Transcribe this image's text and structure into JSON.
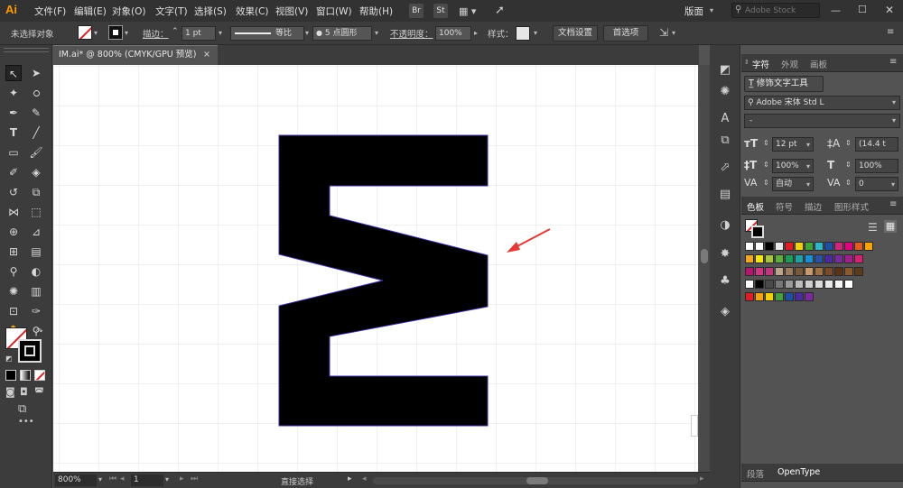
{
  "app": {
    "logo": "Ai"
  },
  "menu": {
    "items": [
      "文件(F)",
      "编辑(E)",
      "对象(O)",
      "文字(T)",
      "选择(S)",
      "效果(C)",
      "视图(V)",
      "窗口(W)",
      "帮助(H)"
    ],
    "br": "Br",
    "st": "St",
    "workspace": "版面",
    "search_placeholder": "Adobe Stock"
  },
  "control": {
    "no_selection": "未选择对象",
    "stroke_label": "描边：",
    "stroke_value": "1 pt",
    "stroke_profile": "等比",
    "brush": "5 点圆形",
    "opacity_label": "不透明度：",
    "opacity_value": "100%",
    "style_label": "样式：",
    "doc_setup": "文档设置",
    "preferences": "首选项"
  },
  "document": {
    "tab_title": "IM.ai* @ 800% (CMYK/GPU 预览)",
    "close": "×"
  },
  "status": {
    "zoom": "800%",
    "artboard": "1",
    "tool": "直接选择"
  },
  "character_panel": {
    "tabs": [
      "字符",
      "外观",
      "画板"
    ],
    "touch_type_button": "修饰文字工具",
    "font_family": "Adobe 宋体 Std L",
    "font_style": "-",
    "font_size": "12 pt",
    "leading": "(14.4 t",
    "vscale": "100%",
    "hscale": "100%",
    "kerning": "自动",
    "tracking": "0"
  },
  "swatches_panel": {
    "tabs": [
      "色板",
      "符号",
      "描边",
      "图形样式"
    ]
  },
  "bottom_panel": {
    "tabs": [
      "段落",
      "OpenType"
    ]
  },
  "colors": {
    "accent": "#ff9a00",
    "artwork": "#000000",
    "arrow": "#e53935",
    "path_outline": "#3a2fa0"
  }
}
